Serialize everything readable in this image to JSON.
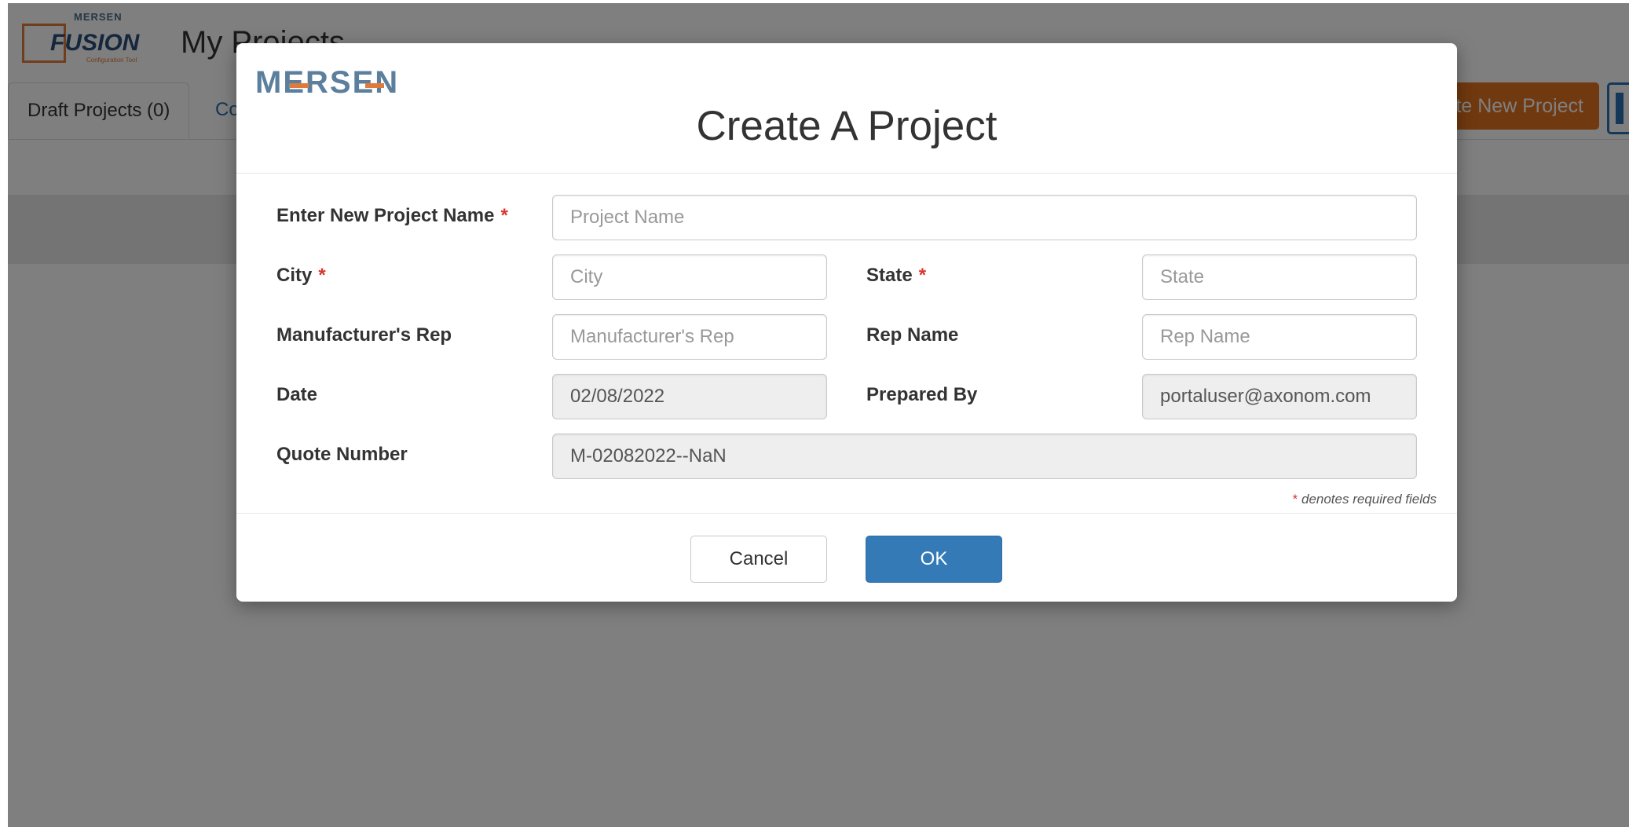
{
  "app": {
    "logo_brand": "MERSEN",
    "logo_product": "FUSION",
    "logo_subtitle": "Configuration Tool",
    "page_title": "My Projects",
    "tabs": [
      {
        "label": "Draft Projects (0)"
      },
      {
        "label": "Co"
      }
    ],
    "create_button_label": "te New Project"
  },
  "modal": {
    "logo_text": "MERSEN",
    "title": "Create A Project",
    "fields": {
      "project_name": {
        "label": "Enter New Project Name",
        "required": "*",
        "placeholder": "Project Name",
        "value": ""
      },
      "city": {
        "label": "City",
        "required": "*",
        "placeholder": "City",
        "value": ""
      },
      "state": {
        "label": "State",
        "required": "*",
        "placeholder": "State",
        "value": ""
      },
      "manufacturers_rep": {
        "label": "Manufacturer's Rep",
        "placeholder": "Manufacturer's Rep",
        "value": ""
      },
      "rep_name": {
        "label": "Rep Name",
        "placeholder": "Rep Name",
        "value": ""
      },
      "date": {
        "label": "Date",
        "value": "02/08/2022"
      },
      "prepared_by": {
        "label": "Prepared By",
        "value": "portaluser@axonom.com"
      },
      "quote_number": {
        "label": "Quote Number",
        "value": "M-02082022--NaN"
      }
    },
    "required_note_star": "*",
    "required_note_text": " denotes required fields",
    "buttons": {
      "cancel": "Cancel",
      "ok": "OK"
    }
  },
  "colors": {
    "accent_orange": "#e2731f",
    "primary_blue": "#337ab7",
    "required_red": "#d9352d"
  }
}
